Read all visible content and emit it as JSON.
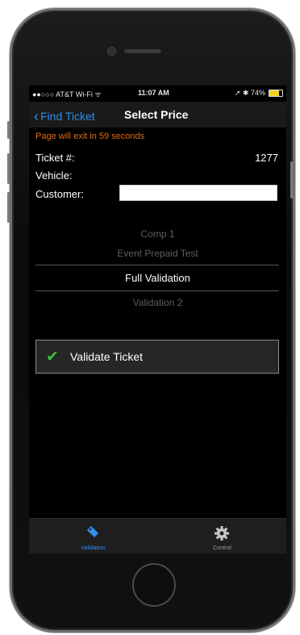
{
  "status_bar": {
    "carrier": "●●○○○ AT&T Wi-Fi ᯤ",
    "time": "11:07 AM",
    "battery_text": "➚ ✱ 74%",
    "battery_level": 0.74,
    "battery_color": "#f2d321"
  },
  "nav": {
    "back_label": "Find Ticket",
    "title": "Select Price"
  },
  "countdown": "Page will exit in 59 seconds",
  "fields": {
    "ticket_label": "Ticket #:",
    "ticket_value": "1277",
    "vehicle_label": "Vehicle:",
    "customer_label": "Customer:",
    "customer_value": ""
  },
  "price_picker": {
    "items": [
      "Comp 1",
      "Event Prepaid Test",
      "Full Validation",
      "Validation 2"
    ],
    "selected": "Full Validation"
  },
  "validate_button": {
    "label": "Validate Ticket",
    "icon": "checkmark-icon"
  },
  "tabs": [
    {
      "label": "Validation",
      "icon": "tag-icon",
      "active": true
    },
    {
      "label": "Control",
      "icon": "gear-icon",
      "active": false
    }
  ],
  "colors": {
    "accent": "#2f8ff0",
    "countdown": "#e06a12",
    "check": "#34c23a"
  }
}
